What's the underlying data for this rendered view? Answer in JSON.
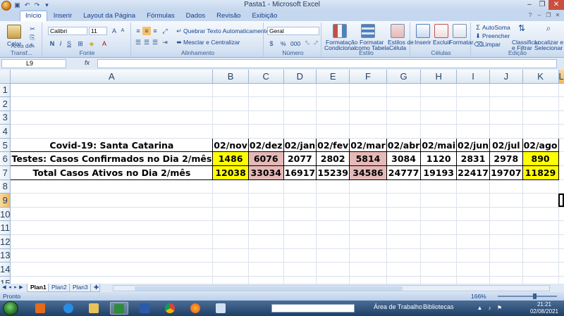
{
  "window": {
    "title": "Pasta1 - Microsoft Excel"
  },
  "ribbon": {
    "tabs": [
      "Início",
      "Inserir",
      "Layout da Página",
      "Fórmulas",
      "Dados",
      "Revisão",
      "Exibição"
    ],
    "active_tab": "Início",
    "clipboard": {
      "label": "Área de Transf...",
      "paste": "Colar"
    },
    "font": {
      "label": "Fonte",
      "name": "Calibri",
      "size": "11",
      "bold": "N",
      "italic": "I",
      "underline": "S"
    },
    "alignment": {
      "label": "Alinhamento",
      "wrap": "Quebrar Texto Automaticamente",
      "merge": "Mesclar e Centralizar"
    },
    "number": {
      "label": "Número",
      "format": "Geral",
      "percent": "%",
      "thousands": "000"
    },
    "styles": {
      "label": "Estilo",
      "conditional": [
        "Formatação",
        "Condicional"
      ],
      "as_table": [
        "Formatar",
        "como Tabela"
      ],
      "cell_styles": [
        "Estilos de",
        "Célula"
      ]
    },
    "cells": {
      "label": "Células",
      "insert": "Inserir",
      "delete": "Excluir",
      "format": "Formatar"
    },
    "editing": {
      "label": "Edição",
      "autosum": "AutoSoma",
      "fill": "Preencher",
      "clear": "Limpar",
      "sort": [
        "Classificar",
        "e Filtrar"
      ],
      "find": [
        "Localizar e",
        "Selecionar"
      ]
    }
  },
  "formula_bar": {
    "name_box": "L9",
    "fx": "fx",
    "content": ""
  },
  "sheet": {
    "columns": [
      "A",
      "B",
      "C",
      "D",
      "E",
      "F",
      "G",
      "H",
      "I",
      "J",
      "K",
      "L"
    ],
    "rows": [
      "1",
      "2",
      "3",
      "4",
      "5",
      "6",
      "7",
      "8",
      "9",
      "10",
      "11",
      "12",
      "13",
      "14",
      "15"
    ],
    "selected_cell": "L9",
    "table": {
      "header": [
        "Covid-19: Santa Catarina",
        "02/nov",
        "02/dez",
        "02/jan",
        "02/fev",
        "02/mar",
        "02/abr",
        "02/mai",
        "02/jun",
        "02/jul",
        "02/ago"
      ],
      "row6": [
        "Testes: Casos Confirmados no Dia 2/mês",
        "1486",
        "6076",
        "2077",
        "2802",
        "5814",
        "3084",
        "1120",
        "2831",
        "2978",
        "890"
      ],
      "row7": [
        "Total Casos Ativos no Dia 2/mês",
        "12038",
        "33034",
        "16917",
        "15239",
        "34586",
        "24777",
        "19193",
        "22417",
        "19707",
        "11829"
      ]
    },
    "highlight_colors": {
      "yellow": "#ffff00",
      "pink": "#e6b8b7"
    }
  },
  "sheet_tabs": [
    "Plan1",
    "Plan2",
    "Plan3"
  ],
  "active_sheet": "Plan1",
  "status": {
    "text": "Pronto",
    "zoom": "166%"
  },
  "taskbar": {
    "search_placeholder": "",
    "desktop_label": "Área de Trabalho",
    "libraries_label": "Bibliotecas",
    "time": "21:21",
    "date": "02/08/2021"
  }
}
